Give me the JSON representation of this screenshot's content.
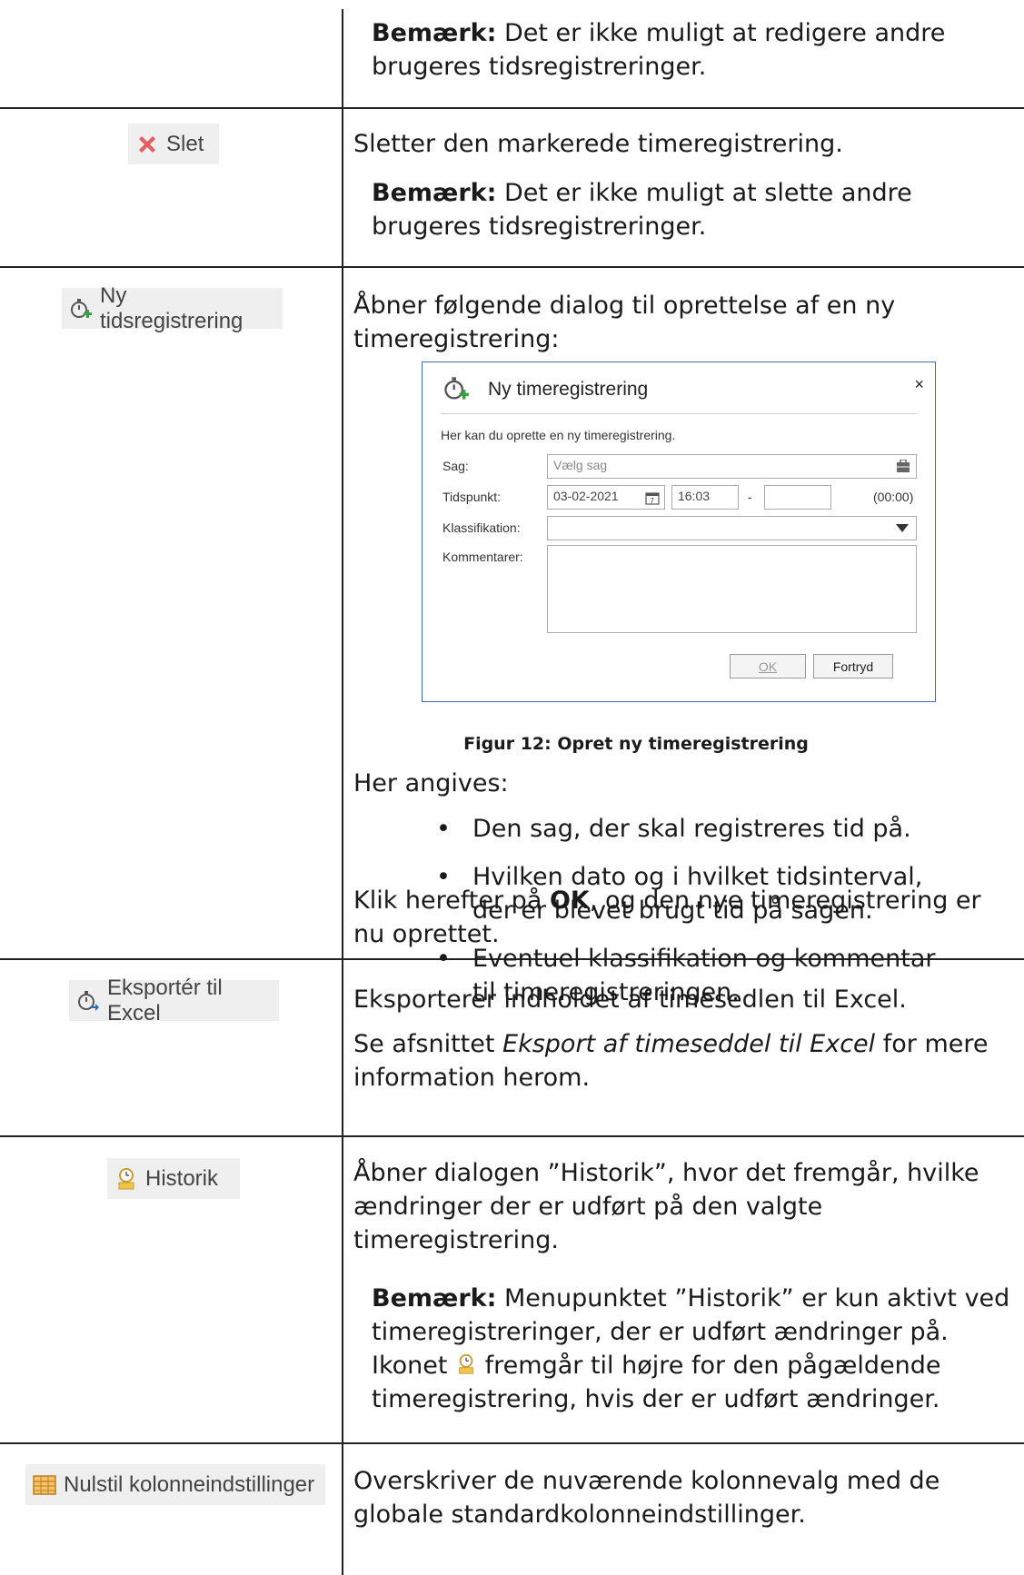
{
  "row1": {
    "note_label": "Bemærk:",
    "note_l1": " Det er ikke muligt at redigere andre",
    "note_l2": "brugeres tidsregistreringer."
  },
  "row2": {
    "button": "Slet",
    "desc": "Sletter den markerede timeregistrering.",
    "note_label": "Bemærk:",
    "note_l1": " Det er ikke muligt at slette andre",
    "note_l2": "brugeres tidsregistreringer."
  },
  "row3": {
    "button": "Ny tidsregistrering",
    "desc_l1": "Åbner følgende dialog til oprettelse af en ny",
    "desc_l2": "timeregistrering:",
    "dialog": {
      "title": "Ny timeregistrering",
      "close": "×",
      "intro": "Her kan du oprette en ny timeregistrering.",
      "sag_label": "Sag:",
      "sag_placeholder": "Vælg sag",
      "tid_label": "Tidspunkt:",
      "date": "03-02-2021",
      "start": "16:03",
      "dash": "-",
      "duration": "(00:00)",
      "klass_label": "Klassifikation:",
      "komm_label": "Kommentarer:",
      "ok": "OK",
      "cancel": "Fortryd"
    },
    "caption": "Figur 12: Opret ny timeregistrering",
    "intro2": "Her angives:",
    "bullets": [
      [
        "Den sag, der skal registreres tid på."
      ],
      [
        "Hvilken dato og i hvilket tidsinterval,",
        "der er blevet brugt tid på sagen."
      ],
      [
        "Eventuel klassifikation og kommentar",
        "til timeregistreringen."
      ]
    ],
    "final_pre": "Klik herefter på ",
    "final_bold": "OK",
    "final_post": ", og den nye timeregistrering er",
    "final_l2": "nu oprettet."
  },
  "row4": {
    "button": "Eksportér til Excel",
    "desc": "Eksporterer indholdet af timesedlen til Excel.",
    "ref_pre": "Se afsnittet ",
    "ref_italic": "Eksport af timeseddel til Excel",
    "ref_post": " for mere",
    "ref_l2": "information herom."
  },
  "row5": {
    "button": "Historik",
    "desc_l1": "Åbner dialogen ”Historik”, hvor det fremgår, hvilke",
    "desc_l2": "ændringer der er udført på den valgte",
    "desc_l3": "timeregistrering.",
    "note_label": "Bemærk:",
    "note_l1": " Menupunktet ”Historik” er kun aktivt ved",
    "note_l2": "timeregistreringer, der er udført ændringer på.",
    "note_l3a": "Ikonet ",
    "note_l3b": " fremgår til højre for den pågældende",
    "note_l4": "timeregistrering, hvis der er udført ændringer."
  },
  "row6": {
    "button": "Nulstil kolonneindstillinger",
    "desc_l1": "Overskriver de nuværende kolonnevalg med de",
    "desc_l2": "globale standardkolonneindstillinger."
  }
}
